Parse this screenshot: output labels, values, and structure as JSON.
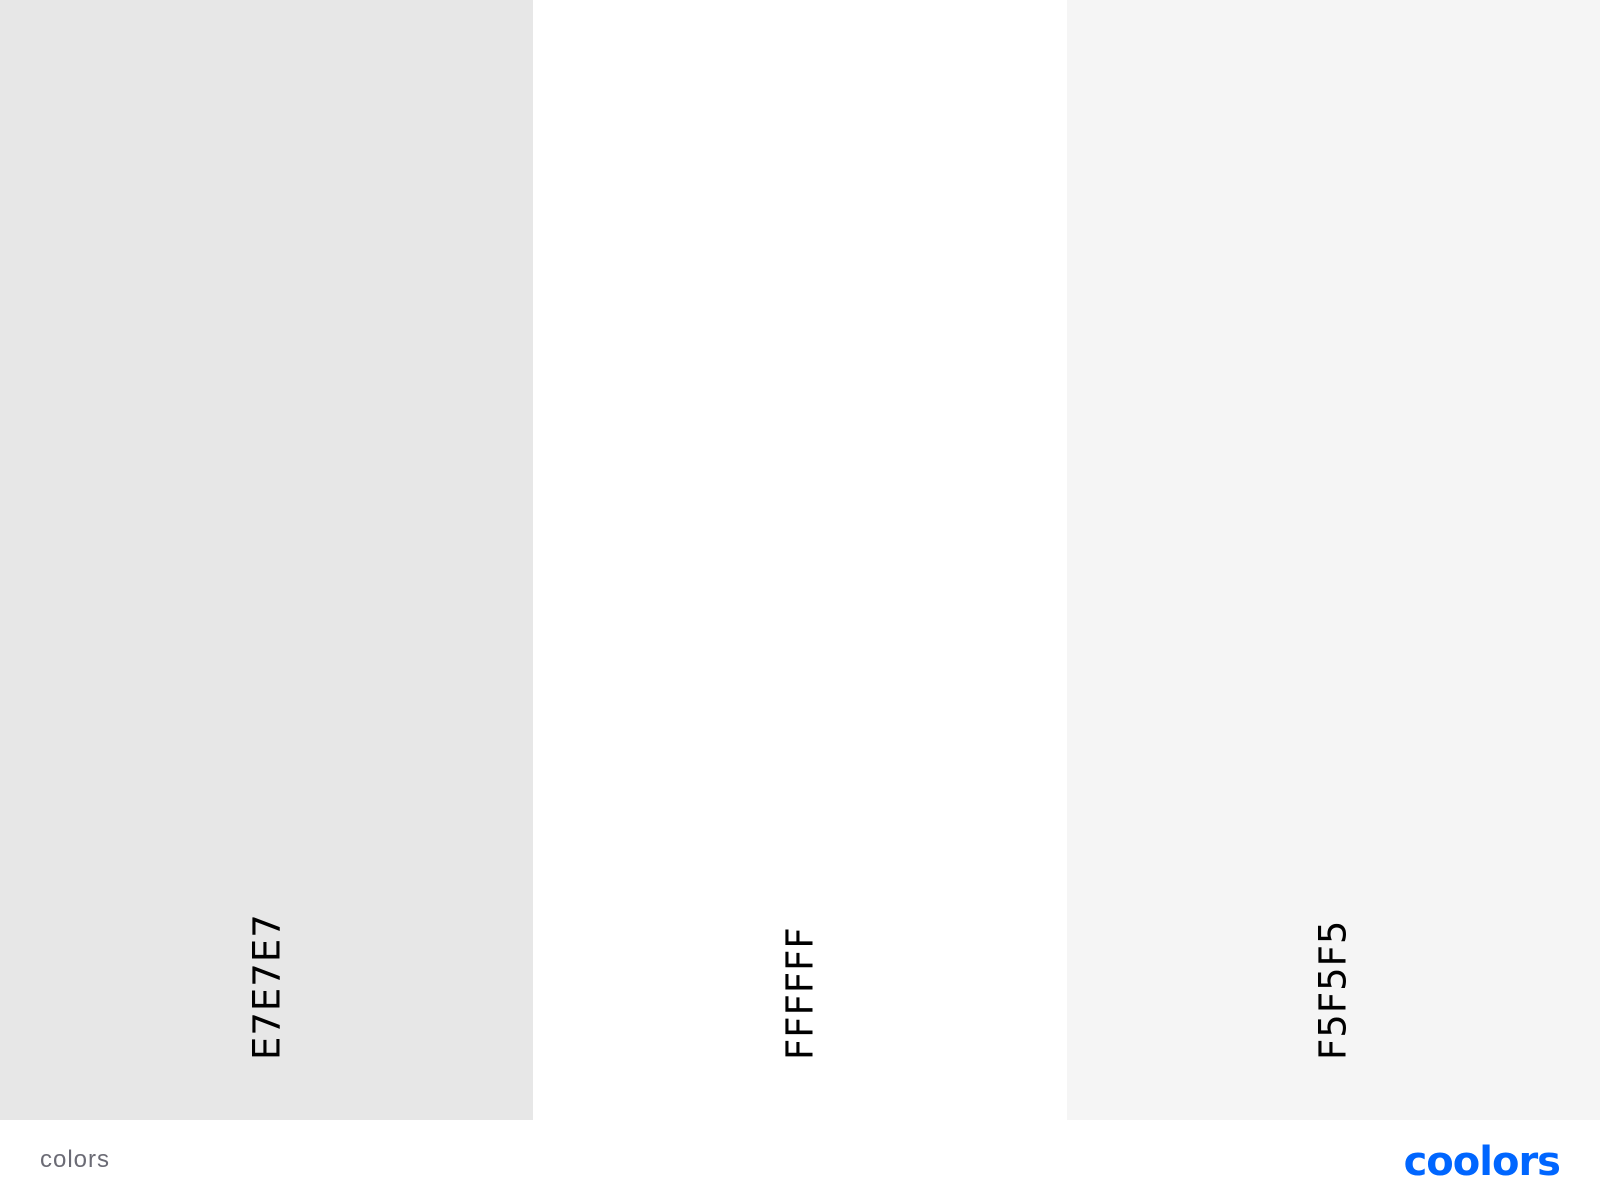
{
  "palette": {
    "swatches": [
      {
        "hex": "E7E7E7",
        "color": "#E7E7E7"
      },
      {
        "hex": "FFFFFF",
        "color": "#FFFFFF"
      },
      {
        "hex": "F5F5F5",
        "color": "#F5F5F5"
      }
    ]
  },
  "footer": {
    "label": "colors",
    "label_color": "#6b6b75",
    "logo_text": "coolors",
    "logo_color": "#0066FF"
  }
}
